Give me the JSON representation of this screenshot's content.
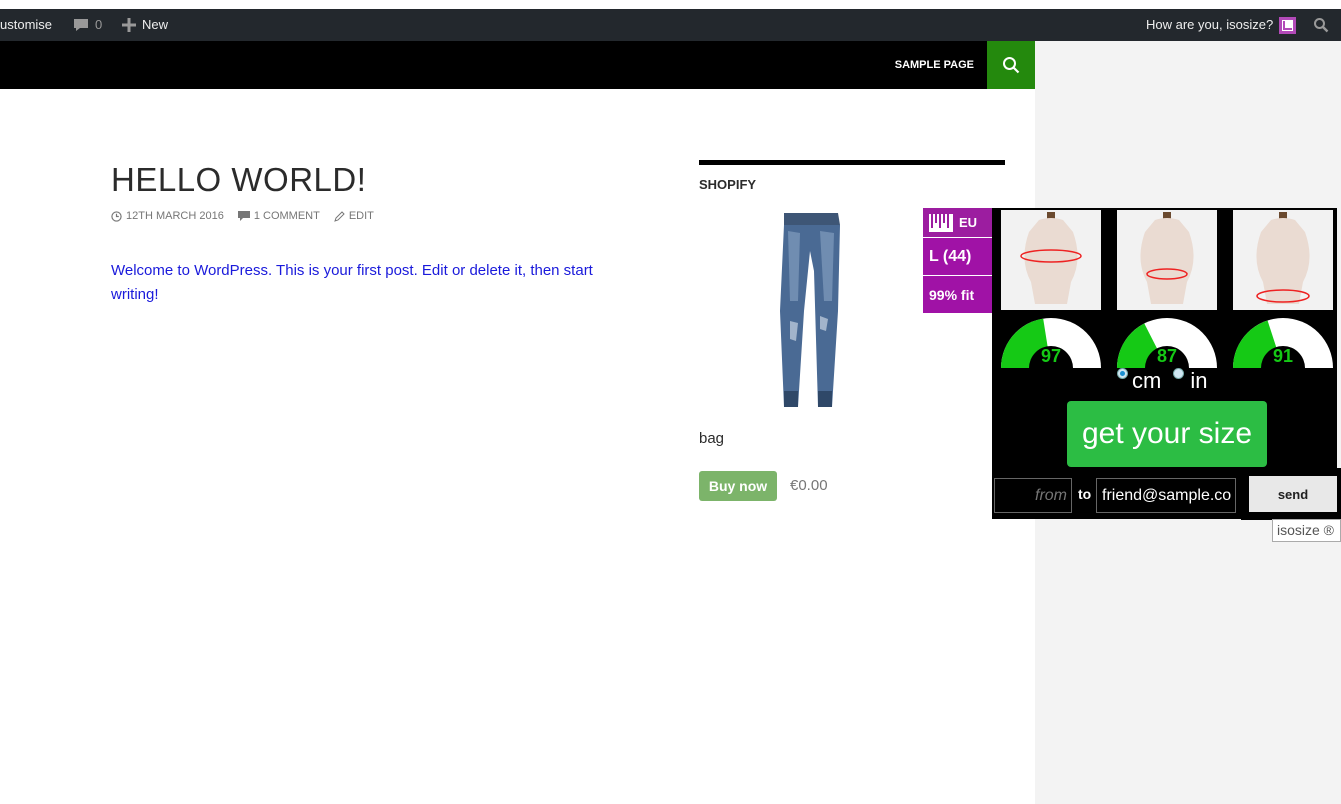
{
  "adminbar": {
    "customise_label": "ustomise",
    "comments_count": "0",
    "new_label": "New",
    "greeting": "How are you, isosize?"
  },
  "nav": {
    "sample_page": "SAMPLE PAGE"
  },
  "post": {
    "title": "HELLO WORLD!",
    "date": "12TH MARCH 2016",
    "comments": "1 COMMENT",
    "edit": "EDIT",
    "content": "Welcome to WordPress. This is your first post. Edit or delete it, then start writing!"
  },
  "widget": {
    "title": "SHOPIFY",
    "product_name": "bag",
    "buy_label": "Buy now",
    "price": "€0.00"
  },
  "isosize": {
    "region": "EU",
    "size": "L (44)",
    "fit": "99% fit",
    "measurements": [
      {
        "value": "97",
        "level": 0.45
      },
      {
        "value": "87",
        "level": 0.35
      },
      {
        "value": "91",
        "level": 0.4
      }
    ],
    "unit_cm": "cm",
    "unit_in": "in",
    "selected_unit": "cm",
    "get_size_label": "get your size",
    "from_placeholder": "from",
    "to_label": "to",
    "email_value": "friend@sample.co",
    "send_label": "send",
    "credit": "isosize ®",
    "colors": {
      "purple": "#a012a6",
      "green": "#15c915",
      "button_green": "#2cbd44"
    }
  }
}
